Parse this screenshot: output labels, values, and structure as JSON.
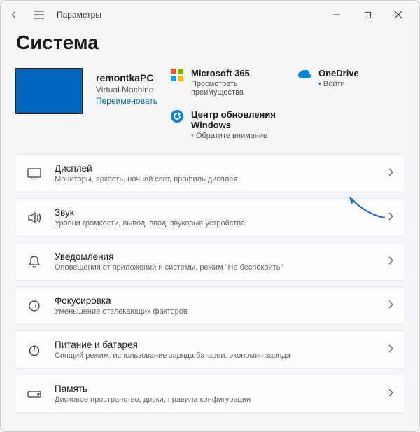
{
  "titlebar": {
    "appTitle": "Параметры"
  },
  "page": {
    "heading": "Система"
  },
  "device": {
    "name": "remontkaPC",
    "sub": "Virtual Machine",
    "renameLink": "Переименовать"
  },
  "tiles": {
    "ms365": {
      "title": "Microsoft 365",
      "sub": "Просмотреть преимущества"
    },
    "onedrive": {
      "title": "OneDrive",
      "sub": "Войти"
    },
    "update": {
      "title": "Центр обновления Windows",
      "sub": "Обратите внимание"
    }
  },
  "settings": [
    {
      "key": "display",
      "title": "Дисплей",
      "sub": "Мониторы, яркость, ночной свет, профиль дисплея"
    },
    {
      "key": "sound",
      "title": "Звук",
      "sub": "Уровни громкости, вывод, ввод, звуковые устройства"
    },
    {
      "key": "notifications",
      "title": "Уведомления",
      "sub": "Оповещения от приложений и системы, режим \"Не беспокоить\""
    },
    {
      "key": "focus",
      "title": "Фокусировка",
      "sub": "Уменьшение отвлекающих факторов"
    },
    {
      "key": "power",
      "title": "Питание и батарея",
      "sub": "Спящий режим, использование заряда батареи, экономия заряда"
    },
    {
      "key": "storage",
      "title": "Память",
      "sub": "Дисковое пространство, диски, правила конфигурации"
    }
  ],
  "icons": {
    "display": "monitor-icon",
    "sound": "speaker-icon",
    "notifications": "bell-icon",
    "focus": "moon-icon",
    "power": "power-icon",
    "storage": "drive-icon"
  }
}
